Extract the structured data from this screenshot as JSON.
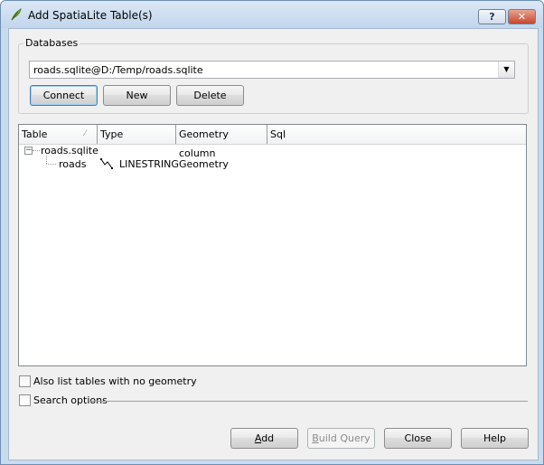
{
  "window": {
    "title": "Add SpatiaLite Table(s)",
    "help_label": "?",
    "close_label": "✕"
  },
  "databases": {
    "group_title": "Databases",
    "selected": "roads.sqlite@D:/Temp/roads.sqlite",
    "buttons": {
      "connect": "Connect",
      "new": "New",
      "delete": "Delete"
    }
  },
  "tree": {
    "columns": [
      "Table",
      "Type",
      "Geometry column",
      "Sql"
    ],
    "sort_glyph": "⁄",
    "db_node": {
      "label": "roads.sqlite",
      "expander": "−"
    },
    "rows": [
      {
        "table": "roads",
        "type": "LINESTRING",
        "type_icon": "linestring-icon",
        "geometry_column": "Geometry",
        "sql": ""
      }
    ]
  },
  "options": {
    "no_geometry": {
      "label": "Also list tables with no geometry",
      "checked": false
    },
    "search_options": {
      "label": "Search options",
      "checked": false
    }
  },
  "footer": {
    "add": {
      "prefix": "",
      "underline": "A",
      "suffix": "dd"
    },
    "build_query": {
      "prefix": "",
      "underline": "B",
      "suffix": "uild Query",
      "enabled": false
    },
    "close": "Close",
    "help": "Help"
  }
}
